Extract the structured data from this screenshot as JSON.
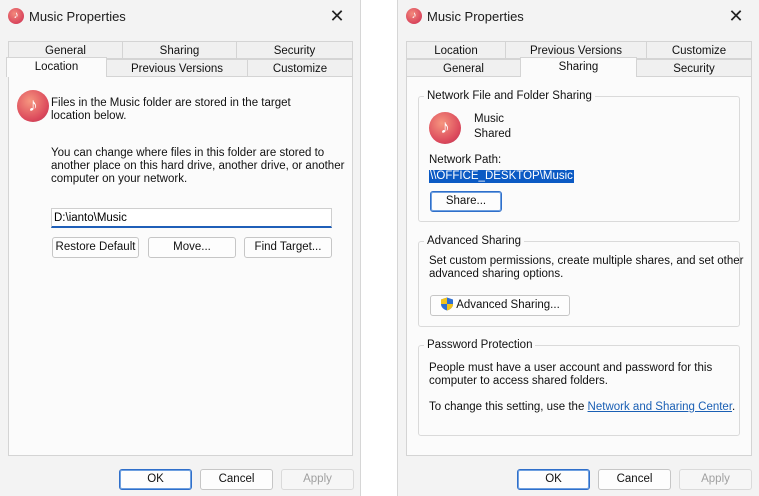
{
  "left_dialog": {
    "title": "Music Properties",
    "tabs_back": [
      "General",
      "Sharing",
      "Security"
    ],
    "tabs_front": [
      "Location",
      "Previous Versions",
      "Customize"
    ],
    "active_tab": "Location",
    "intro_line1": "Files in the Music folder are stored in the target",
    "intro_line2": "location below.",
    "desc_line1": "You can change where files in this folder are stored to",
    "desc_line2": "another place on this hard drive, another drive, or another",
    "desc_line3": "computer on your network.",
    "path_value": "D:\\ianto\\Music",
    "restore_default": "Restore Default",
    "move": "Move...",
    "find_target": "Find Target...",
    "ok": "OK",
    "cancel": "Cancel",
    "apply": "Apply"
  },
  "right_dialog": {
    "title": "Music Properties",
    "tabs_back": [
      "Location",
      "Previous Versions",
      "Customize"
    ],
    "tabs_front": [
      "General",
      "Sharing",
      "Security"
    ],
    "active_tab": "Sharing",
    "network_group_title": "Network File and Folder Sharing",
    "folder_name": "Music",
    "folder_status": "Shared",
    "network_path_label": "Network Path:",
    "network_path_value": "\\\\OFFICE_DESKTOP\\Music",
    "share_button": "Share...",
    "advanced_group_title": "Advanced Sharing",
    "advanced_line1": "Set custom permissions, create multiple shares, and set other",
    "advanced_line2": "advanced sharing options.",
    "advanced_button": "Advanced Sharing...",
    "password_group_title": "Password Protection",
    "password_line1": "People must have a user account and password for this",
    "password_line2": "computer to access shared folders.",
    "change_setting_text": "To change this setting, use the ",
    "network_center_link": "Network and Sharing Center",
    "period": ".",
    "ok": "OK",
    "cancel": "Cancel",
    "apply": "Apply"
  },
  "icons": {
    "app": "music-note-icon",
    "close": "close-icon",
    "shield": "uac-shield-icon"
  },
  "colors": {
    "accent": "#0b5ac4",
    "link": "#1a5fb4",
    "music_icon": "#dc4a5c"
  }
}
